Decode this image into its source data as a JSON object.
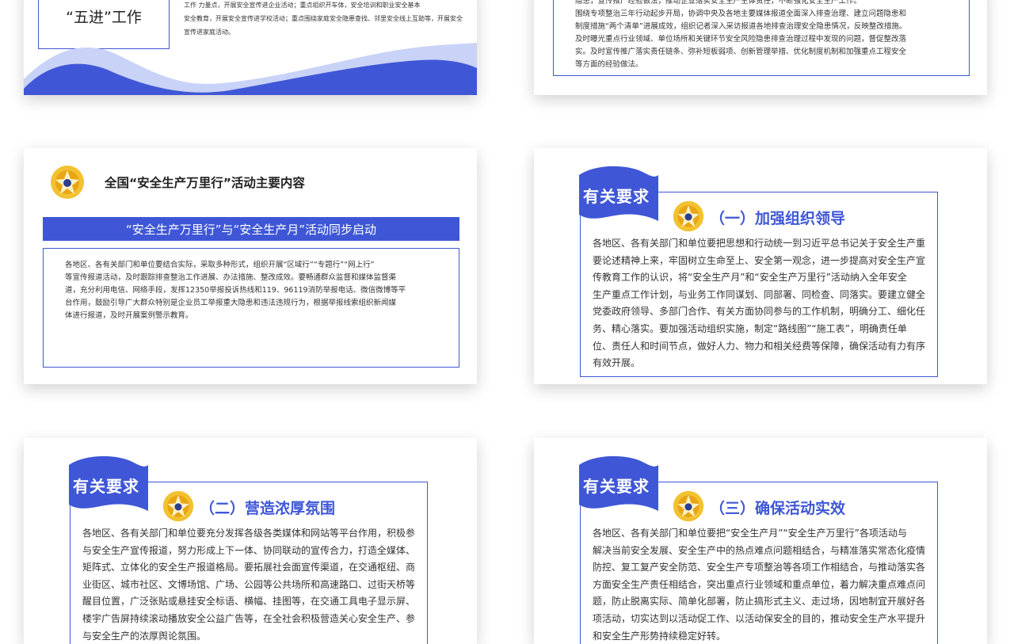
{
  "slide1": {
    "five_jin_title": "“五进”工作",
    "text_lines": [
      "工作 力量点，开展安全宣传进企业活动；重点组织开车体，安全培训和职业安全基本",
      "安全教育，开展安全宣传进学校活动；重点围绕家庭安全隐患查找、邻里安全线上互助等，开展安全",
      "宣传进家庭活动。"
    ]
  },
  "slide2": {
    "text_lines": [
      "隐患，宣传推广经验做法，推动企业落实安全生产主体责任，不断强化安全生产工作。",
      "围绕专项整治三年行动起步开局，协调中央及各地主要媒体报道全面深入排查治理、建立问题隐患和",
      "制度措施“两个清单”进展成效，组织记者深入采访报道各地排查治理安全隐患情况，反映整改措施。",
      "及时曝光重点行业领域、单位场所和关键环节安全风险隐患排查治理过程中发现的问题，督促整改落",
      "实。及时宣传推广落实责任链条、弥补短板弱项、创新管理举措、优化制度机制和加强重点工程安全",
      "等方面的经验做法。"
    ]
  },
  "slide3": {
    "header_title": "全国“安全生产万里行”活动主要内容",
    "banner_title": "“安全生产万里行”与“安全生产月”活动同步启动",
    "text_lines": [
      "各地区、各有关部门和单位要结合实际，采取多种形式，组织开展“区域行”“专题行”“网上行”",
      "等宣传报道活动，及时跟踪排查整治工作进展、办法措施、整改成效。要畅通群众监督和媒体监督渠",
      "道，充分利用电信、网络手段，发挥12350举报投诉热线和119、96119消防举报电话、微信微博等平",
      "台作用，鼓励引导广大群众特别是企业员工举报重大隐患和违法违规行为，根据举报线索组织新闻媒",
      "体进行报道，及时开展案例警示教育。"
    ]
  },
  "slide4": {
    "flag_label": "有关要求",
    "section_title": "（一）加强组织领导",
    "text_lines": [
      "各地区、各有关部门和单位要把思想和行动统一到习近平总书记关于安全生产重",
      "要论述精神上来，牢固树立生命至上、安全第一观念，进一步提高对安全生产宣",
      "传教育工作的认识，将“安全生产月”和“安全生产万里行”活动纳入全年安全",
      "生产重点工作计划，与业务工作同谋划、同部署、同检查、同落实。要建立健全",
      "党委政府领导、多部门合作、有关方面协同参与的工作机制，明确分工、细化任",
      "务、精心落实。要加强活动组织实施，制定“路线图”“施工表”，明确责任单",
      "位、责任人和时间节点，做好人力、物力和相关经费等保障，确保活动有力有序",
      "有效开展。"
    ]
  },
  "slide5": {
    "flag_label": "有关要求",
    "section_title": "（二）营造浓厚氛围",
    "text_lines": [
      "各地区、各有关部门和单位要充分发挥各级各类媒体和网站等平台作用，积极参",
      "与安全生产宣传报道，努力形成上下一体、协同联动的宣传合力，打造全媒体、",
      "矩阵式、立体化的安全生产报道格局。要拓展社会面宣传渠道，在交通枢纽、商",
      "业街区、城市社区、文博场馆、广场、公园等公共场所和高速路口、过街天桥等",
      "醒目位置，广泛张贴或悬挂安全标语、横幅、挂图等，在交通工具电子显示屏、",
      "楼宇广告屏持续滚动播放安全公益广告等，在全社会积极营造关心安全生产、参",
      "与安全生产的浓厚舆论氛围。"
    ]
  },
  "slide6": {
    "flag_label": "有关要求",
    "section_title": "（三）确保活动实效",
    "text_lines": [
      "各地区、各有关部门和单位要把“安全生产月”“安全生产万里行”各项活动与",
      "解决当前安全发展、安全生产中的热点难点问题相结合，与精准落实常态化疫情",
      "防控、复工复产安全防范、安全生产专项整治等各项工作相结合，与推动落实各",
      "方面安全生产责任相结合，突出重点行业领域和重点单位，着力解决重点难点问",
      "题，防止脱离实际、简单化部署，防止搞形式主义、走过场，因地制宜开展好各",
      "项活动，切实达到以活动促工作、以活动保安全的目的，推动安全生产水平提升",
      "和安全生产形势持续稳定好转。"
    ]
  },
  "colors": {
    "accent": "#3f57d6",
    "wave_light": "#c9d2f7",
    "badge_gold": "#e9a516"
  },
  "icons": {
    "badge": "safety-emblem-icon",
    "flag": "blue-flag-banner"
  }
}
